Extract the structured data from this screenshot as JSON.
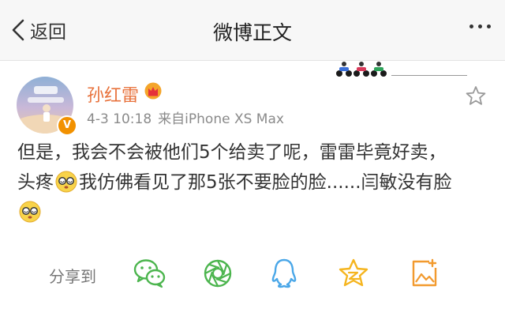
{
  "header": {
    "back_label": "返回",
    "title": "微博正文",
    "back_icon": "chevron-left-icon",
    "more_icon": "more-dots-icon"
  },
  "post": {
    "user_name": "孙红雷",
    "date": "4-3 10:18",
    "source": "来自iPhone XS Max",
    "text_line1": "但是，我会不会被他们5个给卖了呢，雷雷毕竟好卖，",
    "text_line2a": "头疼",
    "text_line2b": "我仿佛看见了那5张不要脸的脸......闫敏没有脸",
    "emoji": "dizzy-face-emoji",
    "verified_badge": "V"
  },
  "share": {
    "label": "分享到",
    "targets": [
      "wechat-icon",
      "moments-icon",
      "qq-icon",
      "qzone-icon",
      "save-image-icon"
    ]
  },
  "colors": {
    "accent_orange": "#e8723c",
    "wechat_green": "#4cb54e",
    "qq_blue": "#4aa7e8",
    "qzone_yellow": "#f5b51f",
    "save_orange": "#f29a2e"
  }
}
